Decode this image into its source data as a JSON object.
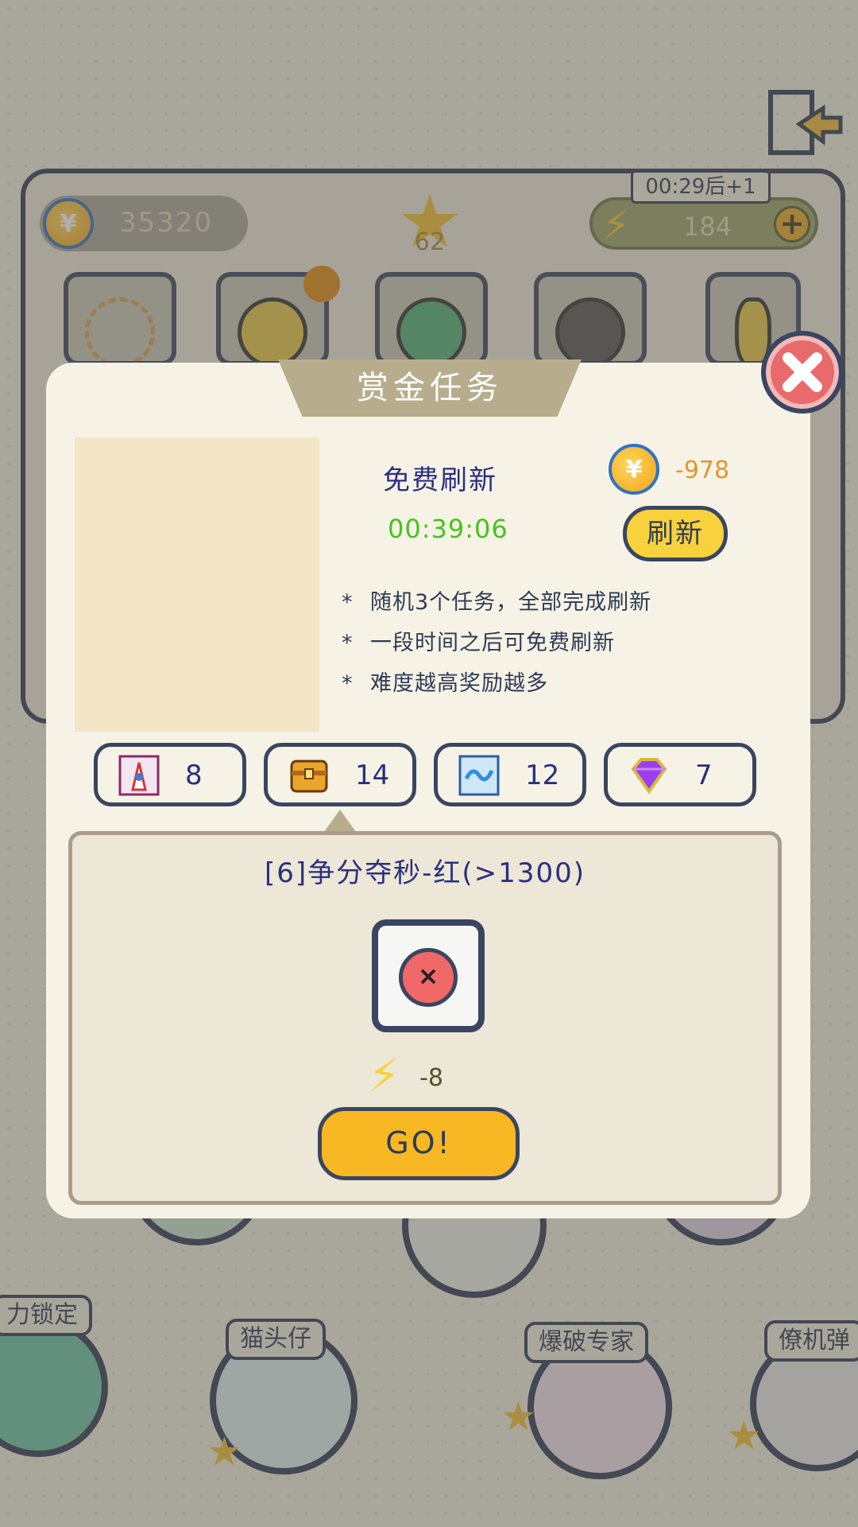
{
  "hud": {
    "coins": "35320",
    "stars": "62",
    "energy": "184",
    "energy_timer": "00:29后+1"
  },
  "background": {
    "level_labels": [
      "力锁定",
      "猫头仔",
      "爆破专家",
      "僚机弹"
    ]
  },
  "popup": {
    "title": "赏金任务",
    "free_refresh_label": "免费刷新",
    "countdown": "00:39:06",
    "refresh_cost": "-978",
    "refresh_button": "刷新",
    "rules": [
      "随机3个任务，全部完成刷新",
      "一段时间之后可免费刷新",
      "难度越高奖励越多"
    ],
    "rule_mark": "*",
    "rewards": [
      {
        "icon": "rocket-card-icon",
        "count": "8"
      },
      {
        "icon": "treasure-chest-icon",
        "count": "14"
      },
      {
        "icon": "wave-card-icon",
        "count": "12"
      },
      {
        "icon": "purple-gem-icon",
        "count": "7"
      }
    ],
    "task": {
      "title": "[6]争分夺秒-红(>1300)",
      "energy_cost": "-8",
      "go_button": "GO!"
    }
  },
  "colors": {
    "accent_yellow": "#f7b823",
    "panel_navy": "#3a4661",
    "countdown_green": "#45c41c",
    "cost_orange": "#e3962c"
  }
}
